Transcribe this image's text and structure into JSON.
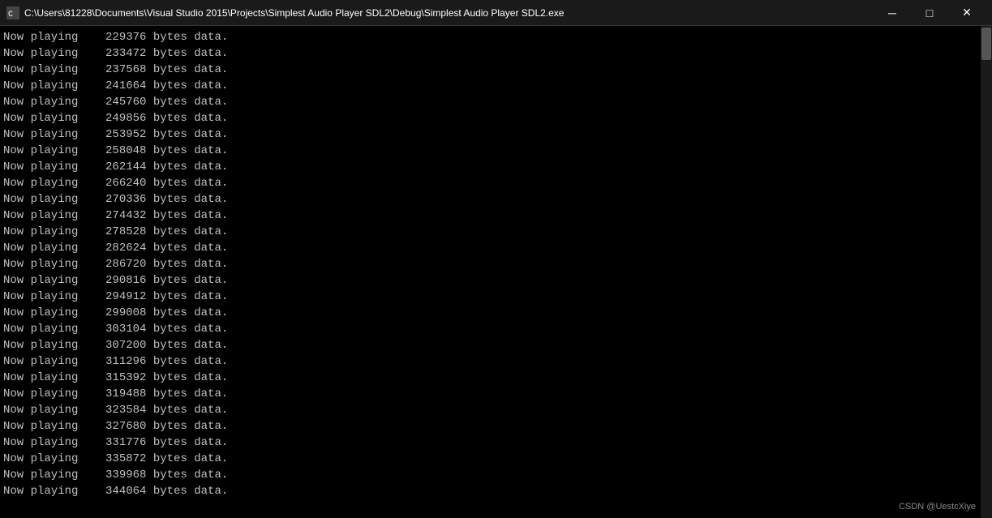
{
  "titleBar": {
    "title": "C:\\Users\\81228\\Documents\\Visual Studio 2015\\Projects\\Simplest Audio Player SDL2\\Debug\\Simplest Audio Player SDL2.exe",
    "minimizeLabel": "─",
    "maximizeLabel": "□",
    "closeLabel": "✕"
  },
  "console": {
    "lines": [
      "Now playing    229376 bytes data.",
      "Now playing    233472 bytes data.",
      "Now playing    237568 bytes data.",
      "Now playing    241664 bytes data.",
      "Now playing    245760 bytes data.",
      "Now playing    249856 bytes data.",
      "Now playing    253952 bytes data.",
      "Now playing    258048 bytes data.",
      "Now playing    262144 bytes data.",
      "Now playing    266240 bytes data.",
      "Now playing    270336 bytes data.",
      "Now playing    274432 bytes data.",
      "Now playing    278528 bytes data.",
      "Now playing    282624 bytes data.",
      "Now playing    286720 bytes data.",
      "Now playing    290816 bytes data.",
      "Now playing    294912 bytes data.",
      "Now playing    299008 bytes data.",
      "Now playing    303104 bytes data.",
      "Now playing    307200 bytes data.",
      "Now playing    311296 bytes data.",
      "Now playing    315392 bytes data.",
      "Now playing    319488 bytes data.",
      "Now playing    323584 bytes data.",
      "Now playing    327680 bytes data.",
      "Now playing    331776 bytes data.",
      "Now playing    335872 bytes data.",
      "Now playing    339968 bytes data.",
      "Now playing    344064 bytes data."
    ]
  },
  "watermark": {
    "text": "CSDN @UestcXiye"
  }
}
